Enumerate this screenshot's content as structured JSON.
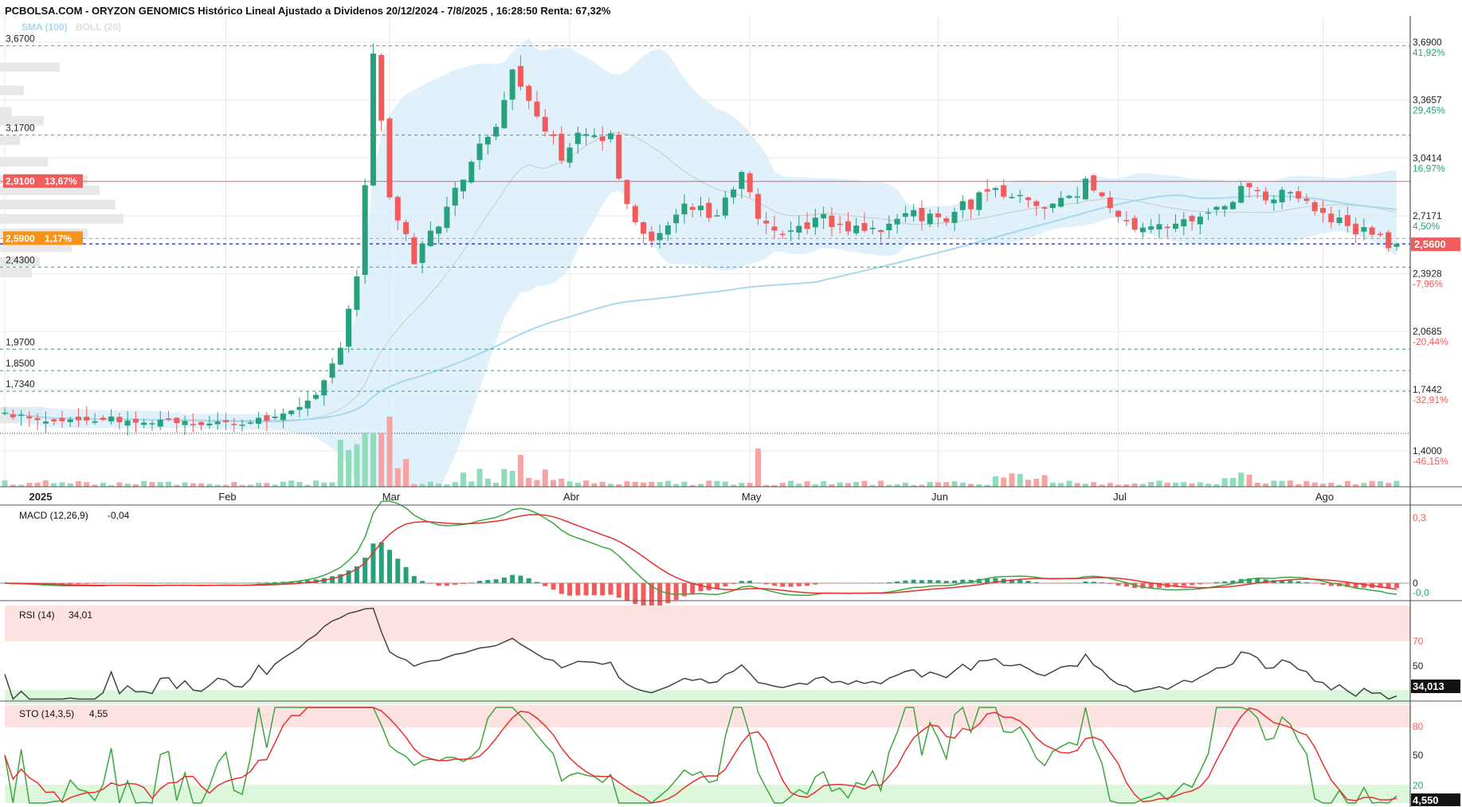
{
  "header": {
    "title": "PCBOLSA.COM - ORYZON GENOMICS Histórico Lineal Ajustado a Dividenos 20/12/2024 - 7/8/2025 , 16:28:50 Renta: 67,32%"
  },
  "legend": {
    "sma": "SMA (100)",
    "boll": "BOLL (20)"
  },
  "colors": {
    "up": "#26a17b",
    "down": "#f25b5b",
    "sma": "#a8d8f0",
    "bollFill": "#d6ecfa",
    "grid": "#e9e9e9",
    "macdLine": "#3ea63e",
    "signalLine": "#e83030",
    "positivePct": "#26a17b",
    "negativePct": "#f25b5b",
    "currentPrice": "#f25b5b",
    "supportOrange": "#f7931a"
  },
  "chart_data": {
    "type": "candlestick",
    "x_range": [
      "2024-12-20",
      "2025-08-07"
    ],
    "month_labels": [
      "2025",
      "Feb",
      "Mar",
      "Abr",
      "May",
      "Jun",
      "Jul",
      "Ago"
    ],
    "right_axis": {
      "ylim": [
        1.3,
        3.76
      ],
      "ticks": [
        {
          "value": 3.69,
          "label": "3,6900",
          "pct": "41,92%"
        },
        {
          "value": 3.3657,
          "label": "3,3657",
          "pct": "29,45%"
        },
        {
          "value": 3.0414,
          "label": "3,0414",
          "pct": "16,97%"
        },
        {
          "value": 2.7171,
          "label": "2,7171",
          "pct": "4,50%"
        },
        {
          "value": 2.3928,
          "label": "2,3928",
          "pct": "-7,96%"
        },
        {
          "value": 2.0685,
          "label": "2,0685",
          "pct": "-20,44%"
        },
        {
          "value": 1.7442,
          "label": "1,7442",
          "pct": "-32,91%"
        },
        {
          "value": 1.4,
          "label": "1,4000",
          "pct": "-46,15%"
        }
      ],
      "current_price": "2,5600"
    },
    "levels": [
      {
        "value": 3.67,
        "label": "3,6700",
        "style": "resistance"
      },
      {
        "value": 3.17,
        "label": "3,1700",
        "style": "resistance"
      },
      {
        "value": 2.91,
        "label": "2,9100",
        "pct": "13,67%",
        "style": "marked-red"
      },
      {
        "value": 2.59,
        "label": "2,5900",
        "pct": "1,17%",
        "style": "marked-orange"
      },
      {
        "value": 2.56,
        "style": "current"
      },
      {
        "value": 2.43,
        "label": "2,4300",
        "style": "support"
      },
      {
        "value": 1.97,
        "label": "1,9700",
        "style": "support"
      },
      {
        "value": 1.85,
        "label": "1,8500",
        "style": "support"
      },
      {
        "value": 1.734,
        "label": "1,7340",
        "style": "support"
      }
    ],
    "price_anchors": [
      {
        "t": 0,
        "v": 1.6
      },
      {
        "t": 6,
        "v": 1.57
      },
      {
        "t": 12,
        "v": 1.58
      },
      {
        "t": 22,
        "v": 1.56
      },
      {
        "t": 30,
        "v": 1.56
      },
      {
        "t": 35,
        "v": 1.62
      },
      {
        "t": 38,
        "v": 1.72
      },
      {
        "t": 41,
        "v": 1.98
      },
      {
        "t": 43,
        "v": 2.4
      },
      {
        "t": 44,
        "v": 2.89
      },
      {
        "t": 45,
        "v": 3.65
      },
      {
        "t": 47,
        "v": 2.85
      },
      {
        "t": 50,
        "v": 2.45
      },
      {
        "t": 55,
        "v": 2.85
      },
      {
        "t": 60,
        "v": 3.25
      },
      {
        "t": 62,
        "v": 3.55
      },
      {
        "t": 65,
        "v": 3.3
      },
      {
        "t": 68,
        "v": 3.05
      },
      {
        "t": 71,
        "v": 3.2
      },
      {
        "t": 74,
        "v": 3.15
      },
      {
        "t": 76,
        "v": 2.75
      },
      {
        "t": 79,
        "v": 2.55
      },
      {
        "t": 83,
        "v": 2.8
      },
      {
        "t": 87,
        "v": 2.7
      },
      {
        "t": 90,
        "v": 3.0
      },
      {
        "t": 92,
        "v": 2.7
      },
      {
        "t": 96,
        "v": 2.6
      },
      {
        "t": 100,
        "v": 2.7
      },
      {
        "t": 105,
        "v": 2.62
      },
      {
        "t": 110,
        "v": 2.72
      },
      {
        "t": 115,
        "v": 2.7
      },
      {
        "t": 120,
        "v": 2.85
      },
      {
        "t": 124,
        "v": 2.82
      },
      {
        "t": 128,
        "v": 2.75
      },
      {
        "t": 132,
        "v": 2.9
      },
      {
        "t": 136,
        "v": 2.68
      },
      {
        "t": 142,
        "v": 2.65
      },
      {
        "t": 148,
        "v": 2.75
      },
      {
        "t": 151,
        "v": 2.85
      },
      {
        "t": 155,
        "v": 2.83
      },
      {
        "t": 158,
        "v": 2.82
      },
      {
        "t": 162,
        "v": 2.72
      },
      {
        "t": 166,
        "v": 2.62
      },
      {
        "t": 170,
        "v": 2.56
      }
    ],
    "macd": {
      "label": "MACD (12,26,9)",
      "value": "-0,04",
      "ylim": [
        -0.06,
        0.33
      ],
      "ticks": [
        "0,3",
        "0",
        "-0,0"
      ]
    },
    "rsi": {
      "label": "RSI (14)",
      "value": "34,01",
      "ticks": [
        "70",
        "50"
      ],
      "current": "34,013"
    },
    "sto": {
      "label": "STO (14,3,5)",
      "value": "4,55",
      "ticks": [
        "80",
        "50",
        "20"
      ],
      "current": "4,550"
    }
  }
}
